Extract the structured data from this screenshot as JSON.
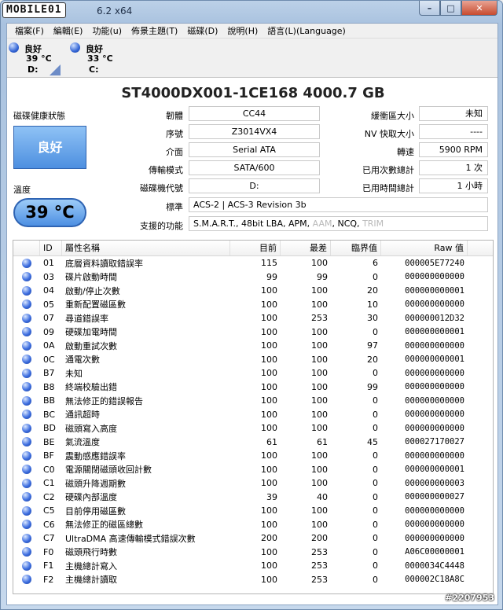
{
  "window": {
    "title_logo": "MOBILE01",
    "title_version": "6.2 x64",
    "btn_min": "–",
    "btn_max": "□",
    "btn_close": "✕"
  },
  "menu": [
    "檔案(F)",
    "編輯(E)",
    "功能(u)",
    "佈景主題(T)",
    "磁碟(D)",
    "說明(H)",
    "語言(L)(Language)"
  ],
  "disks": [
    {
      "status": "良好",
      "temp": "39 °C",
      "letter": "D:"
    },
    {
      "status": "良好",
      "temp": "33 °C",
      "letter": "C:"
    }
  ],
  "model": "ST4000DX001-1CE168  4000.7 GB",
  "health": {
    "label": "磁碟健康狀態",
    "value": "良好"
  },
  "temperature": {
    "label": "溫度",
    "value": "39 °C"
  },
  "info": {
    "firmware_label": "韌體",
    "firmware": "CC44",
    "serial_label": "序號",
    "serial": "Z3014VX4",
    "interface_label": "介面",
    "interface": "Serial ATA",
    "transfer_label": "傳輸模式",
    "transfer": "SATA/600",
    "drive_label": "磁碟機代號",
    "drive": "D:",
    "standard_label": "標準",
    "standard": "ACS-2 | ACS-3 Revision 3b",
    "features_label": "支援的功能",
    "features_active": "S.M.A.R.T., 48bit LBA, APM,",
    "features_aam": "AAM",
    "features_ncq": ", NCQ,",
    "features_trim": "TRIM",
    "buffer_label": "緩衝區大小",
    "buffer": "未知",
    "nvcache_label": "NV 快取大小",
    "nvcache": "----",
    "rpm_label": "轉速",
    "rpm": "5900 RPM",
    "poweron_count_label": "已用次數總計",
    "poweron_count": "1 次",
    "poweron_hours_label": "已用時間總計",
    "poweron_hours": "1 小時"
  },
  "smart": {
    "headers": {
      "id": "ID",
      "name": "屬性名稱",
      "current": "目前",
      "worst": "最差",
      "threshold": "臨界值",
      "raw": "Raw 值"
    },
    "rows": [
      {
        "id": "01",
        "name": "底層資料讀取錯誤率",
        "current": "115",
        "worst": "100",
        "threshold": "6",
        "raw": "000005E77240"
      },
      {
        "id": "03",
        "name": "碟片啟動時間",
        "current": "99",
        "worst": "99",
        "threshold": "0",
        "raw": "000000000000"
      },
      {
        "id": "04",
        "name": "啟動/停止次數",
        "current": "100",
        "worst": "100",
        "threshold": "20",
        "raw": "000000000001"
      },
      {
        "id": "05",
        "name": "重新配置磁區數",
        "current": "100",
        "worst": "100",
        "threshold": "10",
        "raw": "000000000000"
      },
      {
        "id": "07",
        "name": "尋道錯誤率",
        "current": "100",
        "worst": "253",
        "threshold": "30",
        "raw": "000000012D32"
      },
      {
        "id": "09",
        "name": "硬碟加電時間",
        "current": "100",
        "worst": "100",
        "threshold": "0",
        "raw": "000000000001"
      },
      {
        "id": "0A",
        "name": "啟動重試次數",
        "current": "100",
        "worst": "100",
        "threshold": "97",
        "raw": "000000000000"
      },
      {
        "id": "0C",
        "name": "通電次數",
        "current": "100",
        "worst": "100",
        "threshold": "20",
        "raw": "000000000001"
      },
      {
        "id": "B7",
        "name": "未知",
        "current": "100",
        "worst": "100",
        "threshold": "0",
        "raw": "000000000000"
      },
      {
        "id": "B8",
        "name": "終端校驗出錯",
        "current": "100",
        "worst": "100",
        "threshold": "99",
        "raw": "000000000000"
      },
      {
        "id": "BB",
        "name": "無法修正的錯誤報告",
        "current": "100",
        "worst": "100",
        "threshold": "0",
        "raw": "000000000000"
      },
      {
        "id": "BC",
        "name": "通訊超時",
        "current": "100",
        "worst": "100",
        "threshold": "0",
        "raw": "000000000000"
      },
      {
        "id": "BD",
        "name": "磁頭寫入高度",
        "current": "100",
        "worst": "100",
        "threshold": "0",
        "raw": "000000000000"
      },
      {
        "id": "BE",
        "name": "氣流溫度",
        "current": "61",
        "worst": "61",
        "threshold": "45",
        "raw": "000027170027"
      },
      {
        "id": "BF",
        "name": "震動感應錯誤率",
        "current": "100",
        "worst": "100",
        "threshold": "0",
        "raw": "000000000000"
      },
      {
        "id": "C0",
        "name": "電源關閉磁頭收回計數",
        "current": "100",
        "worst": "100",
        "threshold": "0",
        "raw": "000000000001"
      },
      {
        "id": "C1",
        "name": "磁頭升降週期數",
        "current": "100",
        "worst": "100",
        "threshold": "0",
        "raw": "000000000003"
      },
      {
        "id": "C2",
        "name": "硬碟內部溫度",
        "current": "39",
        "worst": "40",
        "threshold": "0",
        "raw": "000000000027"
      },
      {
        "id": "C5",
        "name": "目前停用磁區數",
        "current": "100",
        "worst": "100",
        "threshold": "0",
        "raw": "000000000000"
      },
      {
        "id": "C6",
        "name": "無法修正的磁區總數",
        "current": "100",
        "worst": "100",
        "threshold": "0",
        "raw": "000000000000"
      },
      {
        "id": "C7",
        "name": "UltraDMA 高速傳輸模式錯誤次數",
        "current": "200",
        "worst": "200",
        "threshold": "0",
        "raw": "000000000000"
      },
      {
        "id": "F0",
        "name": "磁頭飛行時數",
        "current": "100",
        "worst": "253",
        "threshold": "0",
        "raw": "A06C00000001"
      },
      {
        "id": "F1",
        "name": "主機總計寫入",
        "current": "100",
        "worst": "253",
        "threshold": "0",
        "raw": "0000034C4448"
      },
      {
        "id": "F2",
        "name": "主機總計讀取",
        "current": "100",
        "worst": "253",
        "threshold": "0",
        "raw": "000002C18A8C"
      }
    ]
  },
  "watermark": "#2207953",
  "colors": {
    "accent": "#4d8fe0",
    "status_good": "#3d6ee0"
  }
}
